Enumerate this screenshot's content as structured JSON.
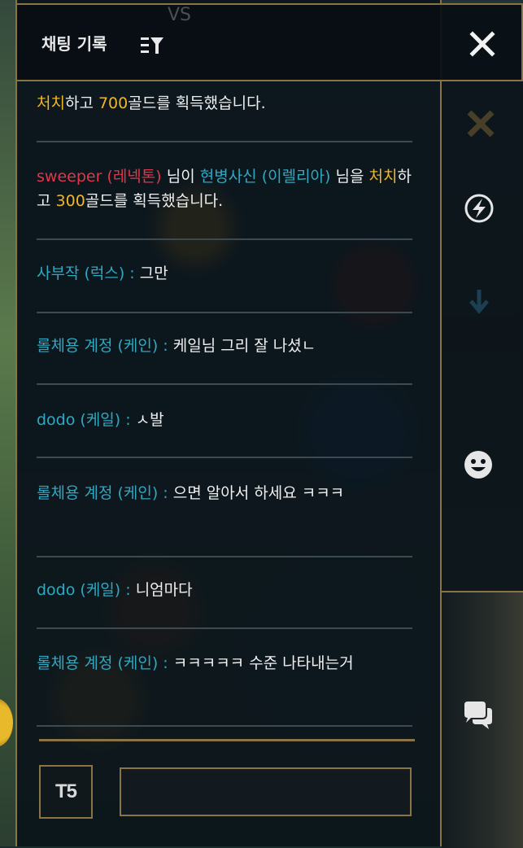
{
  "header": {
    "title": "채팅 기록",
    "faint_overlay": "VS"
  },
  "messages": [
    {
      "parts": [
        {
          "text": "처치",
          "color": "gold"
        },
        {
          "text": "하고 ",
          "color": "white"
        },
        {
          "text": "700",
          "color": "gold"
        },
        {
          "text": "골드를 획득했습니다.",
          "color": "white"
        }
      ]
    },
    {
      "parts": [
        {
          "text": "sweeper (레넥톤)",
          "color": "red"
        },
        {
          "text": " 님이 ",
          "color": "white"
        },
        {
          "text": "현병사신 (이렐리아)",
          "color": "cyan"
        },
        {
          "text": " 님을 ",
          "color": "white"
        },
        {
          "text": "처치",
          "color": "gold"
        },
        {
          "text": "하고 ",
          "color": "white"
        },
        {
          "text": "300",
          "color": "gold"
        },
        {
          "text": "골드를 획득했습니다.",
          "color": "white"
        }
      ]
    },
    {
      "parts": [
        {
          "text": " 사부작 (럭스) : ",
          "color": "cyan"
        },
        {
          "text": "그만",
          "color": "white"
        }
      ]
    },
    {
      "parts": [
        {
          "text": " 롤체용 계정 (케인) : ",
          "color": "cyan"
        },
        {
          "text": "케일님 그리 잘 나셨ㄴ",
          "color": "white"
        }
      ]
    },
    {
      "parts": [
        {
          "text": " dodo (케일) : ",
          "color": "cyan"
        },
        {
          "text": "ㅅ발",
          "color": "white"
        }
      ]
    },
    {
      "parts": [
        {
          "text": " 롤체용 계정 (케인) : ",
          "color": "cyan"
        },
        {
          "text": "으면 알아서 하세요 ㅋㅋㅋ",
          "color": "white"
        }
      ]
    },
    {
      "parts": [
        {
          "text": " dodo (케일) : ",
          "color": "cyan"
        },
        {
          "text": "니엄마다",
          "color": "white"
        }
      ]
    },
    {
      "parts": [
        {
          "text": " 롤체용 계정 (케인) : ",
          "color": "cyan"
        },
        {
          "text": "ㅋㅋㅋㅋㅋ 수준 나타내는거",
          "color": "white"
        }
      ]
    }
  ],
  "input": {
    "team_button_label": "T5",
    "value": "",
    "placeholder": ""
  },
  "sidebar": {
    "icons": [
      "ping-icon",
      "emote-icon",
      "chat-icon"
    ]
  },
  "colors": {
    "gold": "#f0b62a",
    "red": "#e0364a",
    "cyan": "#2fa8c2",
    "border": "#8a7446"
  }
}
